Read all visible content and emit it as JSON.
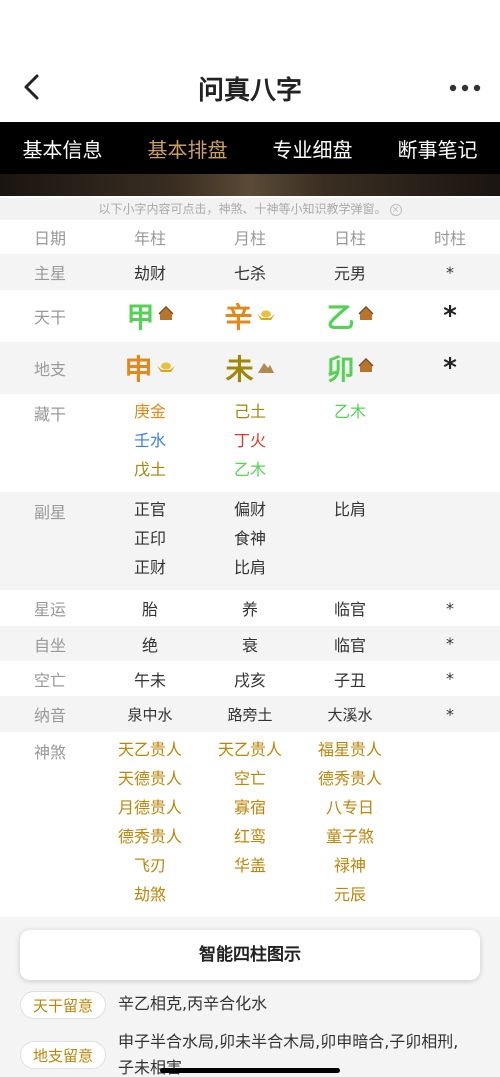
{
  "header": {
    "title": "问真八字"
  },
  "tabs": [
    {
      "label": "基本信息",
      "active": false
    },
    {
      "label": "基本排盘",
      "active": true
    },
    {
      "label": "专业细盘",
      "active": false
    },
    {
      "label": "断事笔记",
      "active": false
    }
  ],
  "hint": "以下小字内容可点击，神煞、十神等小知识教学弹窗。",
  "columns": [
    "日期",
    "年柱",
    "月柱",
    "日柱",
    "时柱"
  ],
  "rows": {
    "main_star": {
      "label": "主星",
      "values": [
        "劫财",
        "七杀",
        "元男",
        "*"
      ]
    },
    "tiangan": {
      "label": "天干",
      "values": [
        "甲",
        "辛",
        "乙",
        "*"
      ]
    },
    "dizhi": {
      "label": "地支",
      "values": [
        "申",
        "未",
        "卯",
        "*"
      ]
    },
    "canggan": {
      "label": "藏干"
    },
    "fuxing": {
      "label": "副星"
    },
    "xingyun": {
      "label": "星运",
      "values": [
        "胎",
        "养",
        "临官",
        "*"
      ]
    },
    "zizuo": {
      "label": "自坐",
      "values": [
        "绝",
        "衰",
        "临官",
        "*"
      ]
    },
    "kongwang": {
      "label": "空亡",
      "values": [
        "午未",
        "戌亥",
        "子丑",
        "*"
      ]
    },
    "nayin": {
      "label": "纳音",
      "values": [
        "泉中水",
        "路旁土",
        "大溪水",
        "*"
      ]
    },
    "shensha": {
      "label": "神煞"
    }
  },
  "canggan": {
    "year": [
      "庚金",
      "壬水",
      "戊土"
    ],
    "month": [
      "己土",
      "丁火",
      "乙木"
    ],
    "day": [
      "乙木"
    ]
  },
  "fuxing": {
    "year": [
      "正官",
      "正印",
      "正财"
    ],
    "month": [
      "偏财",
      "食神",
      "比肩"
    ],
    "day": [
      "比肩"
    ]
  },
  "shensha": {
    "year": [
      "天乙贵人",
      "天德贵人",
      "月德贵人",
      "德秀贵人",
      "飞刃",
      "劫煞"
    ],
    "month": [
      "天乙贵人",
      "空亡",
      "寡宿",
      "红鸾",
      "华盖"
    ],
    "day": [
      "福星贵人",
      "德秀贵人",
      "八专日",
      "童子煞",
      "禄神",
      "元辰"
    ]
  },
  "colors": {
    "wood": "#55d255",
    "metal": "#e08a1e",
    "earth": "#a0860a",
    "water": "#3a7fd8",
    "fire": "#d83a2a",
    "gold": "#b8860b"
  },
  "card": {
    "label": "智能四柱图示"
  },
  "notes": [
    {
      "tag": "天干留意",
      "text": "辛乙相克,丙辛合化水"
    },
    {
      "tag": "地支留意",
      "text": "申子半合水局,卯未半合木局,卯申暗合,子卯相刑,子未相害"
    }
  ]
}
